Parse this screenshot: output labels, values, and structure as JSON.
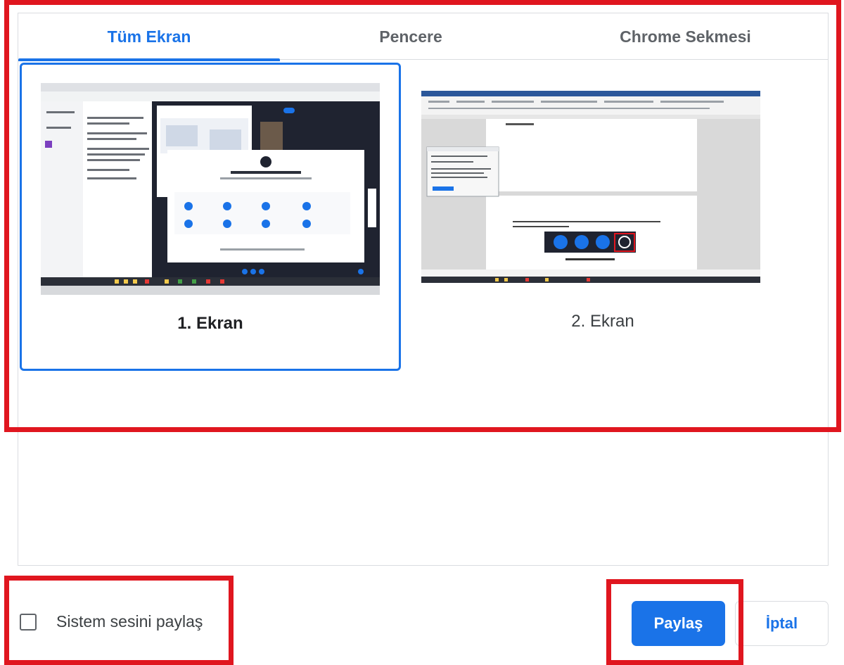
{
  "tabs": [
    {
      "label": "Tüm Ekran",
      "active": true
    },
    {
      "label": "Pencere",
      "active": false
    },
    {
      "label": "Chrome Sekmesi",
      "active": false
    }
  ],
  "screens": [
    {
      "label": "1. Ekran",
      "selected": true
    },
    {
      "label": "2. Ekran",
      "selected": false
    }
  ],
  "audio": {
    "label": "Sistem sesini paylaş",
    "checked": false
  },
  "buttons": {
    "share": "Paylaş",
    "cancel": "İptal"
  },
  "colors": {
    "accent": "#1a73e8",
    "annotation": "#e0161f",
    "border": "#dadce0"
  }
}
